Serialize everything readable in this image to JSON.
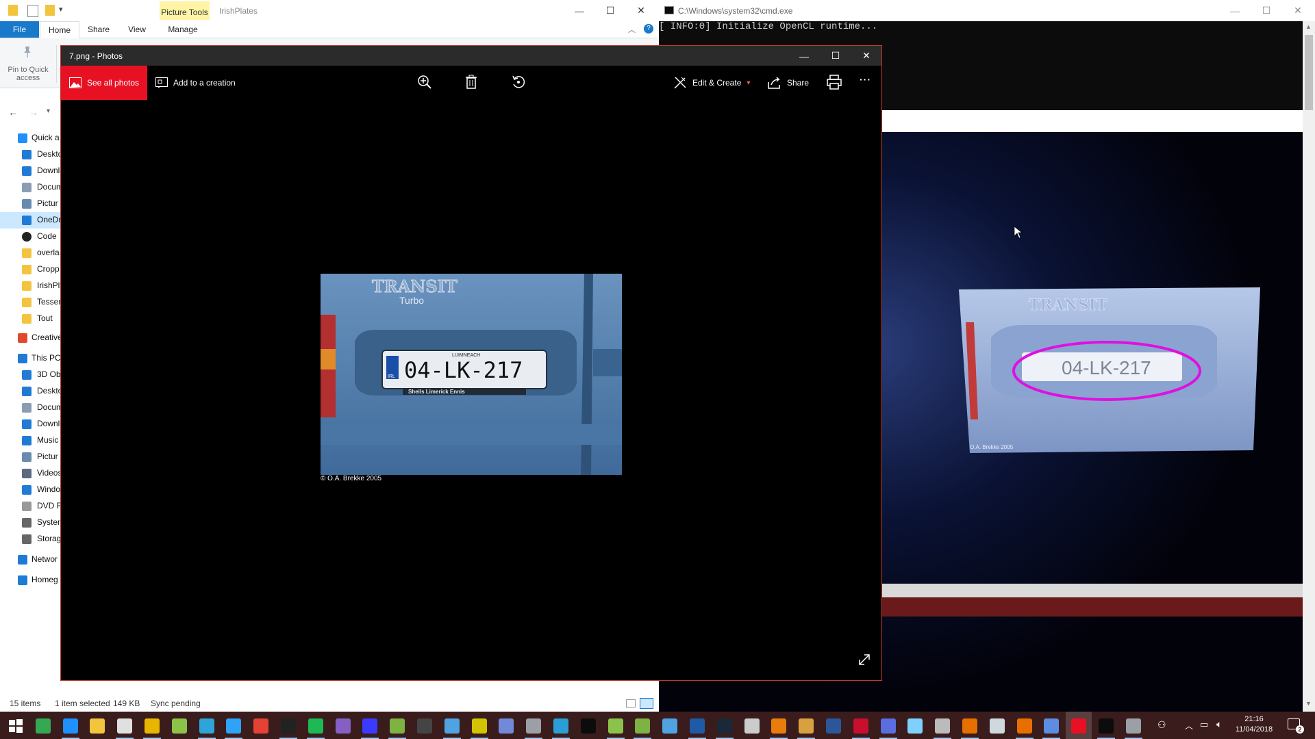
{
  "explorer": {
    "title": "IrishPlates",
    "context_tab": "Picture Tools",
    "tabs": [
      "File",
      "Home",
      "Share",
      "View",
      "Manage"
    ],
    "ribbon_pin": "Pin to Quick access",
    "nav": [
      {
        "label": "Quick a",
        "level": 0,
        "icon": "star-icon",
        "color": "#1e90ff"
      },
      {
        "label": "Deskto",
        "level": 1,
        "icon": "desktop-icon",
        "color": "#1f7bd6"
      },
      {
        "label": "Downl",
        "level": 1,
        "icon": "download-icon",
        "color": "#1f7bd6"
      },
      {
        "label": "Docum",
        "level": 1,
        "icon": "document-icon",
        "color": "#8a9db3"
      },
      {
        "label": "Pictur",
        "level": 1,
        "icon": "pictures-icon",
        "color": "#6a8bb0"
      },
      {
        "label": "OneDr",
        "level": 1,
        "icon": "cloud-icon",
        "color": "#1f7bd6",
        "selected": true
      },
      {
        "label": "Code",
        "level": 1,
        "icon": "github-icon",
        "color": "#222222"
      },
      {
        "label": "overla",
        "level": 1,
        "icon": "folder-icon",
        "color": "#f3c43e"
      },
      {
        "label": "Cropp",
        "level": 1,
        "icon": "folder-icon",
        "color": "#f3c43e"
      },
      {
        "label": "IrishPl",
        "level": 1,
        "icon": "folder-icon",
        "color": "#f3c43e"
      },
      {
        "label": "Tesser",
        "level": 1,
        "icon": "folder-icon",
        "color": "#f3c43e"
      },
      {
        "label": "Tout",
        "level": 1,
        "icon": "folder-icon",
        "color": "#f3c43e"
      },
      {
        "label": "Creative",
        "level": 0,
        "icon": "creative-cloud-icon",
        "color": "#e04a2a"
      },
      {
        "label": "This PC",
        "level": 0,
        "icon": "computer-icon",
        "color": "#1f7bd6"
      },
      {
        "label": "3D Ob",
        "level": 1,
        "icon": "cube-icon",
        "color": "#1f7bd6"
      },
      {
        "label": "Deskto",
        "level": 1,
        "icon": "desktop-icon",
        "color": "#1f7bd6"
      },
      {
        "label": "Docum",
        "level": 1,
        "icon": "document-icon",
        "color": "#8a9db3"
      },
      {
        "label": "Downl",
        "level": 1,
        "icon": "download-icon",
        "color": "#1f7bd6"
      },
      {
        "label": "Music",
        "level": 1,
        "icon": "music-icon",
        "color": "#1f7bd6"
      },
      {
        "label": "Pictur",
        "level": 1,
        "icon": "pictures-icon",
        "color": "#6a8bb0"
      },
      {
        "label": "Videos",
        "level": 1,
        "icon": "video-icon",
        "color": "#5a6b80"
      },
      {
        "label": "Windo",
        "level": 1,
        "icon": "drive-icon",
        "color": "#1f7bd6"
      },
      {
        "label": "DVD R",
        "level": 1,
        "icon": "dvd-icon",
        "color": "#999999"
      },
      {
        "label": "Systen",
        "level": 1,
        "icon": "drive-icon",
        "color": "#666666"
      },
      {
        "label": "Storag",
        "level": 1,
        "icon": "drive-icon",
        "color": "#666666"
      },
      {
        "label": "Networ",
        "level": 0,
        "icon": "network-icon",
        "color": "#1f7bd6"
      },
      {
        "label": "Homeg",
        "level": 0,
        "icon": "homegroup-icon",
        "color": "#1f7bd6"
      }
    ],
    "status": {
      "items": "15 items",
      "selected": "1 item selected",
      "size": "149 KB",
      "sync": "Sync pending"
    }
  },
  "cmd": {
    "title": "C:\\Windows\\system32\\cmd.exe",
    "line1": "[ INFO:0] Initialize OpenCL runtime..."
  },
  "photos": {
    "title": "7.png - Photos",
    "see_all": "See all photos",
    "add_creation": "Add to a creation",
    "edit_create": "Edit & Create",
    "share": "Share",
    "more": "···",
    "image": {
      "brand": "TRANSIT",
      "model": "Turbo",
      "plate_county": "LUIMNEACH",
      "plate": "04-LK-217",
      "plate_ctry": "IRL",
      "dealer": "Sheils  Limerick  Ennis",
      "copyright": "© O.A. Brekke 2005"
    }
  },
  "camera": {
    "brand": "TRANSIT",
    "plate": "04-LK-217",
    "copyright": "O.A. Brekke 2005",
    "highlight_color": "#e010e0"
  },
  "taskbar": {
    "time": "21:16",
    "date": "11/04/2018",
    "notifications": "2",
    "apps": [
      {
        "name": "start-icon",
        "color": "#ffffff"
      },
      {
        "name": "chrome-icon",
        "color": "#34a853"
      },
      {
        "name": "edge-icon",
        "color": "#1e90ff"
      },
      {
        "name": "file-explorer-icon",
        "color": "#f3c43e"
      },
      {
        "name": "mail-icon",
        "color": "#e0e0e0"
      },
      {
        "name": "slack-icon",
        "color": "#e8b600"
      },
      {
        "name": "notepad-icon",
        "color": "#8bc34a"
      },
      {
        "name": "vim-icon",
        "color": "#2ea4d8"
      },
      {
        "name": "photoshop-icon",
        "color": "#2fa3f7"
      },
      {
        "name": "animate-icon",
        "color": "#e34234"
      },
      {
        "name": "epic-games-icon",
        "color": "#222222"
      },
      {
        "name": "spotify-icon",
        "color": "#1db954"
      },
      {
        "name": "visual-studio-icon",
        "color": "#865fc5"
      },
      {
        "name": "terminal-icon",
        "color": "#3b3bff"
      },
      {
        "name": "hs-icon",
        "color": "#7cb342"
      },
      {
        "name": "w-icon",
        "color": "#444444"
      },
      {
        "name": "box-icon",
        "color": "#4fa3e0"
      },
      {
        "name": "tool-icon",
        "color": "#d4c300"
      },
      {
        "name": "discord-icon",
        "color": "#7289da"
      },
      {
        "name": "tray-icon",
        "color": "#9aa0a6"
      },
      {
        "name": "store-icon",
        "color": "#2a9fd6"
      },
      {
        "name": "cmd-icon",
        "color": "#0c0c0c"
      },
      {
        "name": "android-icon",
        "color": "#8bc34a"
      },
      {
        "name": "utorrent-icon",
        "color": "#7cb342"
      },
      {
        "name": "network-tool-icon",
        "color": "#4fa3e0"
      },
      {
        "name": "remote-icon",
        "color": "#1e5aa8"
      },
      {
        "name": "steam-icon",
        "color": "#1b2838"
      },
      {
        "name": "mic-icon",
        "color": "#cccccc"
      },
      {
        "name": "blender-icon",
        "color": "#e87d0d"
      },
      {
        "name": "paint-icon",
        "color": "#d9a03f"
      },
      {
        "name": "word-icon",
        "color": "#2b579a"
      },
      {
        "name": "flag-icon",
        "color": "#c8102e"
      },
      {
        "name": "settings-icon",
        "color": "#5b6ee1"
      },
      {
        "name": "pen-icon",
        "color": "#7fd0ff"
      },
      {
        "name": "printer-icon",
        "color": "#bbbbbb"
      },
      {
        "name": "java-icon",
        "color": "#e76f00"
      },
      {
        "name": "files-icon",
        "color": "#cfd8dc"
      },
      {
        "name": "java2-icon",
        "color": "#e76f00"
      },
      {
        "name": "devices-icon",
        "color": "#5c8de0"
      },
      {
        "name": "photos-icon",
        "color": "#e81123"
      },
      {
        "name": "cmd2-icon",
        "color": "#0c0c0c"
      },
      {
        "name": "window-icon",
        "color": "#9aa0a6"
      }
    ]
  }
}
